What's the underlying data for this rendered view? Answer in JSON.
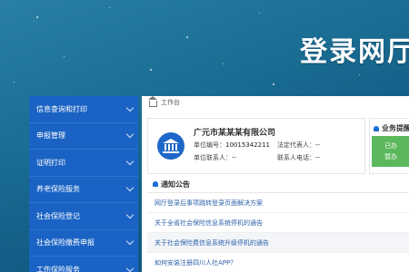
{
  "watermark": "登录网厅",
  "breadcrumb": {
    "label": "工作台"
  },
  "sidebar": {
    "items": [
      {
        "label": "信息查询和打印"
      },
      {
        "label": "申报管理"
      },
      {
        "label": "证明打印"
      },
      {
        "label": "养老保险服务"
      },
      {
        "label": "社会保险登记"
      },
      {
        "label": "社会保险缴费申报"
      },
      {
        "label": "工伤保险服务"
      }
    ]
  },
  "unit": {
    "name": "广元市某某某有限公司",
    "code_label": "单位编号：",
    "code_value": "10015342211",
    "legal_label": "法定代表人：",
    "legal_value": "--",
    "contact_label": "单位联系人：",
    "contact_value": "--",
    "phone_label": "联系人电话：",
    "phone_value": "--"
  },
  "business": {
    "title": "业务提醒",
    "button_line1": "已办",
    "button_line2": "暂办"
  },
  "notices": {
    "title": "通知公告",
    "items": [
      "网厅登录后事项跳转登录页面解决方案",
      "关于全省社会保险信息系统停机的通告",
      "关于社会保险费信息系统升级停机的通告",
      "如何安装注册四川人社APP？"
    ]
  },
  "colors": {
    "sidebar_bg": "#1a63c4",
    "accent_green": "#5cb85c",
    "link_blue": "#2b5fa8"
  }
}
